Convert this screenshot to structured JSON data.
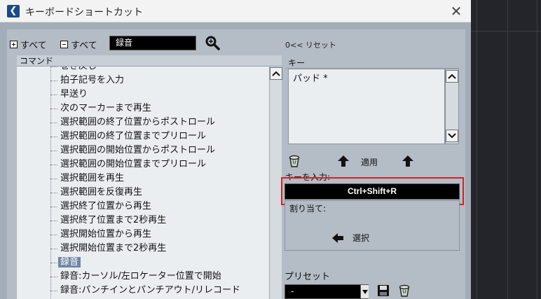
{
  "window": {
    "title": "キーボードショートカット",
    "close_glyph": "✕",
    "app_icon_glyph": "❮"
  },
  "toolbar": {
    "expand_all_label": "すべて",
    "collapse_all_label": "すべて",
    "search_value": "録音"
  },
  "commands": {
    "header": "コマンド",
    "items": [
      "巻き戻し",
      "拍子記号を入力",
      "早送り",
      "次のマーカーまで再生",
      "選択範囲の終了位置からポストロール",
      "選択範囲の終了位置までプリロール",
      "選択範囲の開始位置からポストロール",
      "選択範囲の開始位置までプリロール",
      "選択範囲を再生",
      "選択範囲を反復再生",
      "選択終了位置から再生",
      "選択終了位置まで2秒再生",
      "選択開始位置から再生",
      "選択開始位置まで2秒再生",
      "録音",
      "録音:カーソル/左ロケーター位置で開始",
      "録音:パンチインとパンチアウト/リレコード"
    ],
    "selected_item": "録音"
  },
  "keys": {
    "reset_label": "0<< リセット",
    "header": "キー",
    "list": [
      "パッド *"
    ],
    "apply_label": "適用"
  },
  "key_input": {
    "label": "キーを入力:",
    "value": "Ctrl+Shift+R"
  },
  "assign": {
    "label": "割り当て:",
    "select_label": "選択"
  },
  "preset": {
    "label": "プリセット",
    "value": "-"
  },
  "colors": {
    "highlight": "#d42424",
    "selected_row": "#6f85a3"
  }
}
